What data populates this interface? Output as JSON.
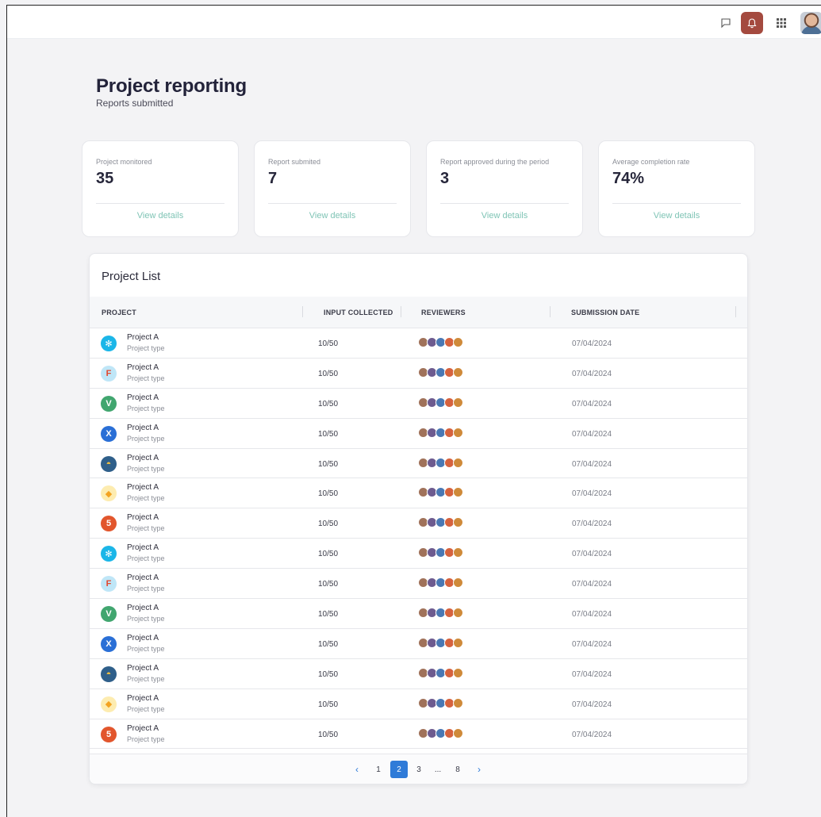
{
  "header": {
    "title": "Project reporting",
    "subtitle": "Reports submitted"
  },
  "topbar": {
    "icons": [
      "chat-icon",
      "bell-icon",
      "apps-grid-icon",
      "user-avatar"
    ],
    "bell_color": "#a44a3f"
  },
  "stats": [
    {
      "label": "Project monitored",
      "value": "35",
      "link": "View details"
    },
    {
      "label": "Report submited",
      "value": "7",
      "link": "View details"
    },
    {
      "label": "Report approved during the period",
      "value": "3",
      "link": "View details"
    },
    {
      "label": "Average completion rate",
      "value": "74%",
      "link": "View details"
    }
  ],
  "list": {
    "title": "Project List",
    "columns": [
      "PROJECT",
      "INPUT COLLECTED",
      "REVIEWERS",
      "SUBMISSION DATE"
    ],
    "rows": [
      {
        "name": "Project A",
        "type": "Project type",
        "input": "10/50",
        "date": "07/04/2024",
        "icon": "react-icon"
      },
      {
        "name": "Project A",
        "type": "Project type",
        "input": "10/50",
        "date": "07/04/2024",
        "icon": "figma-icon"
      },
      {
        "name": "Project A",
        "type": "Project type",
        "input": "10/50",
        "date": "07/04/2024",
        "icon": "vue-icon"
      },
      {
        "name": "Project A",
        "type": "Project type",
        "input": "10/50",
        "date": "07/04/2024",
        "icon": "xd-icon"
      },
      {
        "name": "Project A",
        "type": "Project type",
        "input": "10/50",
        "date": "07/04/2024",
        "icon": "python-icon"
      },
      {
        "name": "Project A",
        "type": "Project type",
        "input": "10/50",
        "date": "07/04/2024",
        "icon": "sketch-icon"
      },
      {
        "name": "Project A",
        "type": "Project type",
        "input": "10/50",
        "date": "07/04/2024",
        "icon": "html5-icon"
      },
      {
        "name": "Project A",
        "type": "Project type",
        "input": "10/50",
        "date": "07/04/2024",
        "icon": "react-icon"
      },
      {
        "name": "Project A",
        "type": "Project type",
        "input": "10/50",
        "date": "07/04/2024",
        "icon": "figma-icon"
      },
      {
        "name": "Project A",
        "type": "Project type",
        "input": "10/50",
        "date": "07/04/2024",
        "icon": "vue-icon"
      },
      {
        "name": "Project A",
        "type": "Project type",
        "input": "10/50",
        "date": "07/04/2024",
        "icon": "xd-icon"
      },
      {
        "name": "Project A",
        "type": "Project type",
        "input": "10/50",
        "date": "07/04/2024",
        "icon": "python-icon"
      },
      {
        "name": "Project A",
        "type": "Project type",
        "input": "10/50",
        "date": "07/04/2024",
        "icon": "sketch-icon"
      },
      {
        "name": "Project A",
        "type": "Project type",
        "input": "10/50",
        "date": "07/04/2024",
        "icon": "html5-icon"
      }
    ]
  },
  "pagination": {
    "prev": "‹",
    "pages": [
      "1",
      "2",
      "3",
      "...",
      "8"
    ],
    "active": "2",
    "next": "›"
  },
  "colors": {
    "accent": "#2f7bd8",
    "link": "#7fc4b5"
  }
}
